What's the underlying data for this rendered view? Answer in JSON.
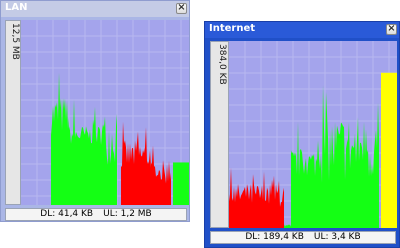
{
  "colors": {
    "download": "#ff0000",
    "upload": "#14ff14",
    "graph_bg": "#a4a4ec",
    "lan_frame": "#aab6e6",
    "lan_title": "#c4cbe6",
    "internet_frame": "#2050c8",
    "internet_title": "#2a5ad8",
    "level_bar": "#ffff00"
  },
  "windows": [
    {
      "id": "lan",
      "title": "LAN",
      "scale_label": "12,5 MB",
      "status": {
        "dl": "DL: 41,4 KB",
        "ul": "UL: 1,2 MB"
      },
      "close_icon": "close-icon",
      "level_bar": {
        "color": "#14ff14",
        "fraction": 0.23
      }
    },
    {
      "id": "internet",
      "title": "Internet",
      "scale_label": "384,0 KB",
      "status": {
        "dl": "DL: 189,4 KB",
        "ul": "UL: 3,4 KB"
      },
      "close_icon": "close-icon",
      "level_bar": {
        "color": "#ffff00",
        "fraction": 0.83
      }
    }
  ]
}
